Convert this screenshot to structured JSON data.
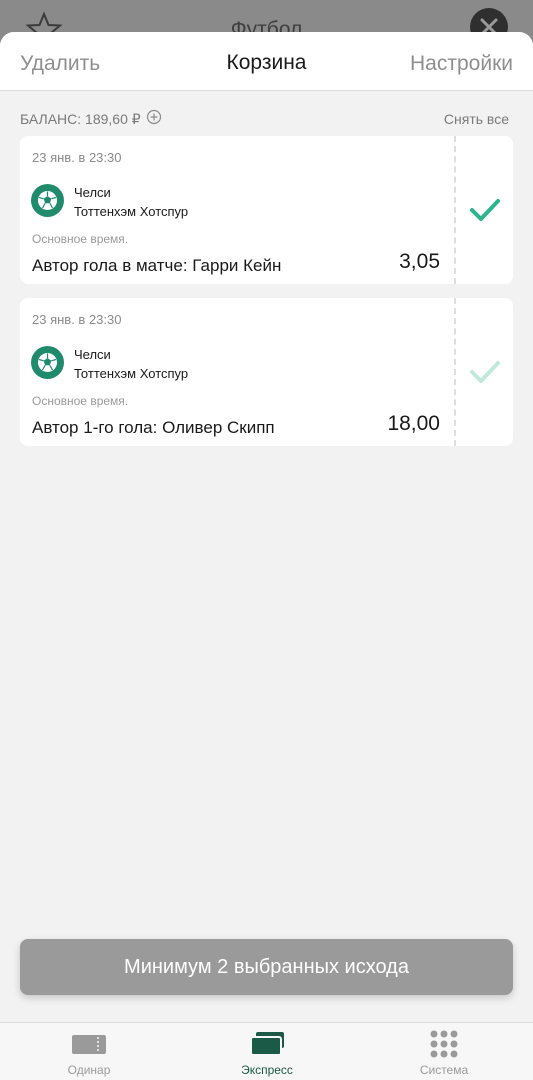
{
  "background": {
    "title": "Футбол"
  },
  "header": {
    "delete_label": "Удалить",
    "title": "Корзина",
    "settings_label": "Настройки"
  },
  "balance": {
    "text": "БАЛАНС: 189,60 ₽",
    "clear_all_label": "Снять все"
  },
  "bets": [
    {
      "date": "23 янв. в 23:30",
      "home": "Челси",
      "away": "Тоттенхэм Хотспур",
      "period": "Основное время.",
      "market": "Автор гола в матче: Гарри Кейн",
      "odds": "3,05",
      "selected": true
    },
    {
      "date": "23 янв. в 23:30",
      "home": "Челси",
      "away": "Тоттенхэм Хотспур",
      "period": "Основное время.",
      "market": "Автор 1-го гола: Оливер Скипп",
      "odds": "18,00",
      "selected": false
    }
  ],
  "action": {
    "min_button_label": "Минимум 2 выбранных исхода"
  },
  "tabs": [
    {
      "label": "Одинар",
      "icon": "ticket-icon",
      "active": false
    },
    {
      "label": "Экспресс",
      "icon": "stacked-cards-icon",
      "active": true
    },
    {
      "label": "Система",
      "icon": "grid-dots-icon",
      "active": false
    }
  ],
  "colors": {
    "accent_green": "#2bb58c",
    "accent_green_light": "#bfe9dc",
    "tab_active": "#1a5a46",
    "button_disabled": "#9a9a9a"
  }
}
